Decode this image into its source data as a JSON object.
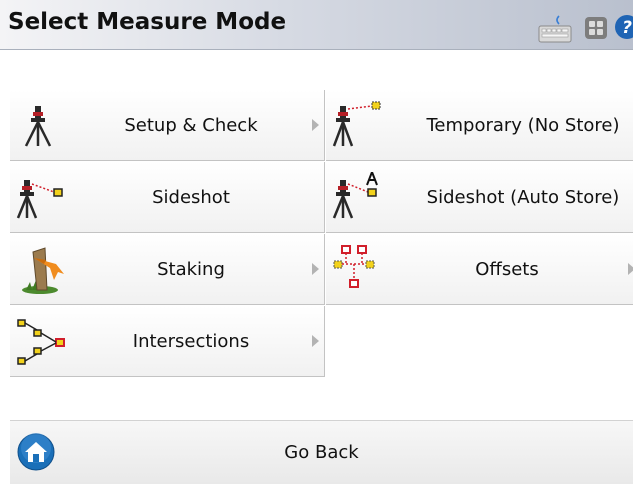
{
  "title": "Select Measure Mode",
  "toolbar_icons": [
    "keyboard-icon",
    "grid-icon",
    "help-icon"
  ],
  "menu": {
    "setup_check": "Setup & Check",
    "temporary": "Temporary (No Store)",
    "sideshot": "Sideshot",
    "sideshot_auto": "Sideshot (Auto Store)",
    "staking": "Staking",
    "offsets": "Offsets",
    "intersections": "Intersections"
  },
  "footer": {
    "go_back": "Go Back"
  },
  "colors": {
    "accent_red": "#d11f2b",
    "accent_yellow": "#f2d21c",
    "home_blue": "#1a6fb8"
  }
}
